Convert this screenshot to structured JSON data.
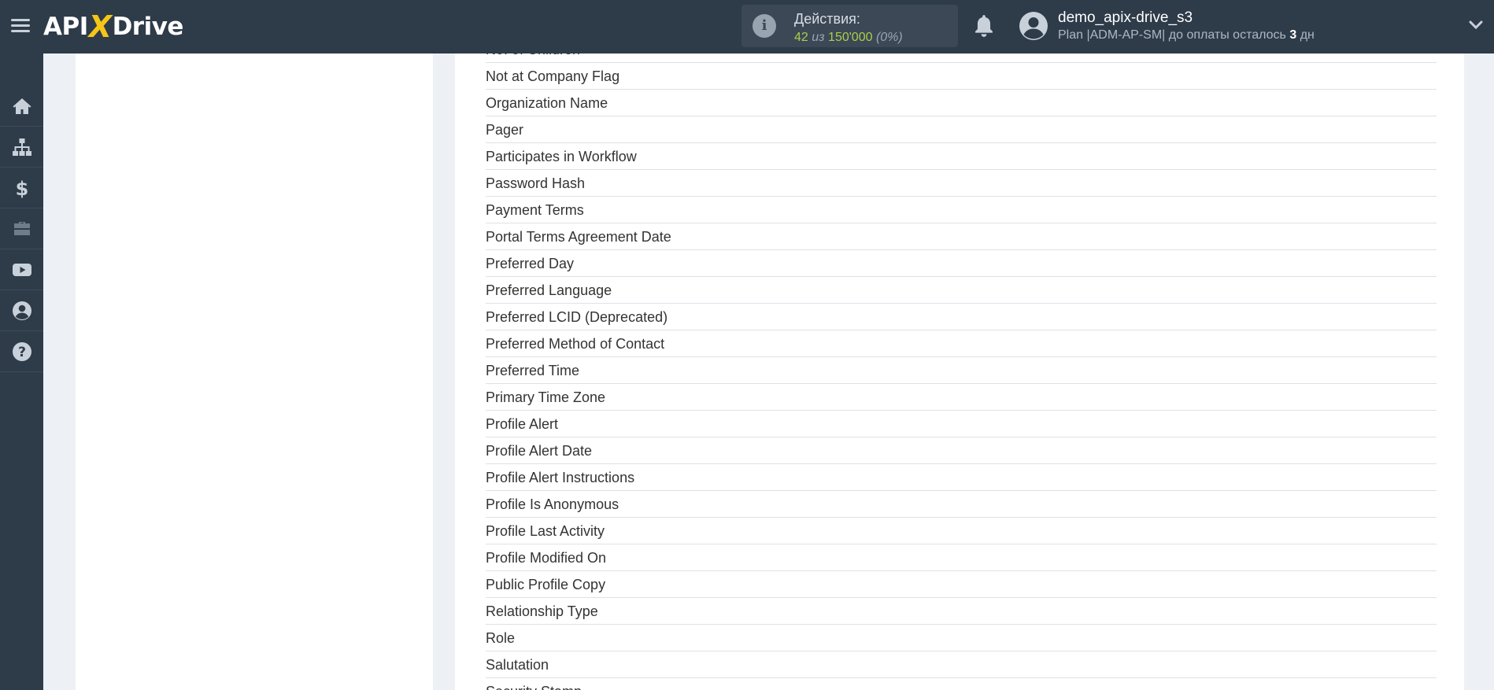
{
  "header": {
    "logo": {
      "prefix": "API",
      "x": "X",
      "suffix": "Drive"
    },
    "actions": {
      "label": "Действия:",
      "used": "42",
      "separator": "из",
      "total": "150'000",
      "percent": "(0%)"
    },
    "user": {
      "name": "demo_apix-drive_s3",
      "plan_prefix": "Plan |ADM-AP-SM| до оплаты осталось",
      "days": "3",
      "days_unit": "дн"
    }
  },
  "sidebar": {
    "items": [
      {
        "name": "home",
        "icon": "home-icon"
      },
      {
        "name": "connections",
        "icon": "sitemap-icon"
      },
      {
        "name": "billing",
        "icon": "dollar-icon"
      },
      {
        "name": "briefcase",
        "icon": "briefcase-icon"
      },
      {
        "name": "video",
        "icon": "youtube-icon"
      },
      {
        "name": "profile",
        "icon": "user-circle-icon"
      },
      {
        "name": "help",
        "icon": "question-icon"
      }
    ]
  },
  "fields": {
    "items": [
      "No. of Children",
      "Not at Company Flag",
      "Organization Name",
      "Pager",
      "Participates in Workflow",
      "Password Hash",
      "Payment Terms",
      "Portal Terms Agreement Date",
      "Preferred Day",
      "Preferred Language",
      "Preferred LCID (Deprecated)",
      "Preferred Method of Contact",
      "Preferred Time",
      "Primary Time Zone",
      "Profile Alert",
      "Profile Alert Date",
      "Profile Alert Instructions",
      "Profile Is Anonymous",
      "Profile Last Activity",
      "Profile Modified On",
      "Public Profile Copy",
      "Relationship Type",
      "Role",
      "Salutation",
      "Security Stamp"
    ]
  },
  "colors": {
    "topbar": "#2e3b49",
    "accent_yellow": "#f5c518",
    "accent_green": "#a8cf4a",
    "background": "#edf1f5"
  }
}
